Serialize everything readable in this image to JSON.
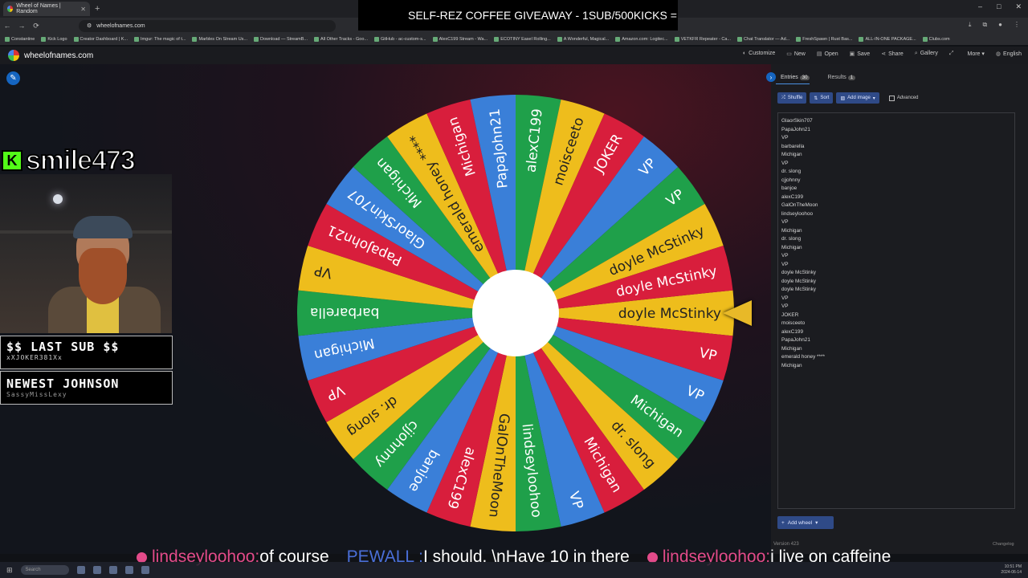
{
  "browser": {
    "tab_title": "Wheel of Names | Random",
    "new_tab": "+",
    "url": "wheelofnames.com",
    "window_controls": [
      "–",
      "□",
      "✕"
    ],
    "nav": [
      "←",
      "→",
      "⟳"
    ],
    "bookmarks": [
      "Constantine",
      "Kick Logo",
      "Creator Dashboard | K...",
      "Imgur: The magic of t...",
      "Marbles On Stream Us...",
      "Download — StreamB...",
      "All Other Tracks - Goo...",
      "GitHub - ac-custom-s...",
      "AlexC199 Stream - Wa...",
      "ECOTINY Easel Rolling...",
      "A Wonderful, Magical...",
      "Amazon.com: Logitec...",
      "VETKFR Repeater - Ca...",
      "Chat Translator — Ad...",
      "FreshSpawn | Rust Bas...",
      "ALL-IN-ONE PACKAGE...",
      "Clubs.com"
    ]
  },
  "banner": {
    "text": "SELF-REZ COFFEE GIVEAWAY - 1SUB/500KICKS ="
  },
  "site": {
    "name": "wheelofnames.com",
    "menu": [
      "Customize",
      "New",
      "Open",
      "Save",
      "Share",
      "Gallery",
      "",
      "More",
      "English"
    ]
  },
  "overlay": {
    "kick_badge": "K",
    "username": "smile473",
    "last_sub_title": "$$ LAST SUB $$",
    "last_sub_name": "xXJOKER381Xx",
    "newest_title": "NEWEST JOHNSON",
    "newest_name": "SassyMissLexy"
  },
  "wheel": {
    "segments": [
      "doyle McStinky",
      "VP",
      "VP",
      "Michigan",
      "dr. slong",
      "Michigan",
      "VP",
      "lindseyloohoo",
      "GalOnTheMoon",
      "alexC199",
      "banjoe",
      "cjjohnny",
      "dr. slong",
      "VP",
      "Michigan",
      "barbarella",
      "VP",
      "PapaJohn21",
      "GlaorSkin707",
      "Michigan",
      "emerald honey ****",
      "Michigan",
      "PapaJohn21",
      "alexC199",
      "moisceeto",
      "JOKER",
      "VP",
      "VP",
      "doyle McStinky",
      "doyle McStinky"
    ],
    "colors": [
      "#eebd1c",
      "#d81e3c",
      "#3a7fd8",
      "#1fa04a"
    ]
  },
  "panel": {
    "tab_entries": "Entries",
    "entries_count": "30",
    "tab_results": "Results",
    "results_count": "1",
    "shuffle": "Shuffle",
    "sort": "Sort",
    "add_image": "Add image",
    "advanced": "Advanced",
    "entries": [
      "GlaorSkin707",
      "PapaJohn21",
      "VP",
      "barbarella",
      "Michigan",
      "VP",
      "dr. slong",
      "cjjohnny",
      "banjoe",
      "alexC199",
      "GalOnTheMoon",
      "lindseyloohoo",
      "VP",
      "Michigan",
      "dr. slong",
      "Michigan",
      "VP",
      "VP",
      "doyle McStinky",
      "doyle McStinky",
      "doyle McStinky",
      "VP",
      "VP",
      "JOKER",
      "moisceeto",
      "alexC199",
      "PapaJohn21",
      "Michigan",
      "emerald honey ****",
      "Michigan"
    ],
    "add_wheel": "Add wheel",
    "version": "Version 423",
    "changelog": "Changelog"
  },
  "ticker": {
    "items": [
      {
        "user": "lindseyloohoo:",
        "msg": "of course"
      },
      {
        "user": "PEWALL :",
        "msg": "I should. \\nHave 10 in there"
      },
      {
        "user": "lindseyloohoo:",
        "msg": "i live on caffeine"
      }
    ]
  },
  "taskbar": {
    "search": "Search",
    "clock_time": "10:51 PM",
    "clock_date": "2024-06-14"
  }
}
